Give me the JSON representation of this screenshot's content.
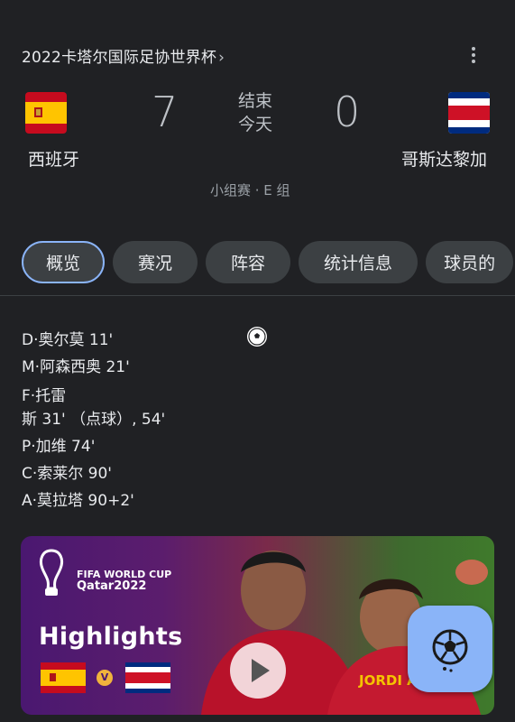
{
  "match": {
    "competition": "2022卡塔尔国际足协世界杯",
    "competition_chevron": "›",
    "home_team": "西班牙",
    "away_team": "哥斯达黎加",
    "home_score": "7",
    "away_score": "0",
    "status_line1": "结束",
    "status_line2": "今天",
    "group": "小组赛 · E 组"
  },
  "tabs": [
    {
      "label": "概览",
      "active": true
    },
    {
      "label": "赛况"
    },
    {
      "label": "阵容"
    },
    {
      "label": "统计信息"
    },
    {
      "label": "球员的"
    }
  ],
  "scorers": [
    "D·奥尔莫 11'",
    "M·阿森西奥 21'",
    "F·托雷",
    "斯 31' （点球）, 54'",
    "P·加维 74'",
    "C·索莱尔 90'",
    "A·莫拉塔 90+2'"
  ],
  "highlight_card": {
    "brand_line1": "FIFA WORLD CUP",
    "brand_line2": "Qatar2022",
    "title": "Highlights",
    "vs_badge": "V"
  },
  "icons": {
    "more": "more-vert-icon",
    "goal": "soccer-ball-icon",
    "play": "play-icon",
    "fab": "soccer-ball-icon"
  },
  "colors": {
    "background": "#202124",
    "accent": "#8ab4f8",
    "tab_bg": "#3c4043"
  }
}
